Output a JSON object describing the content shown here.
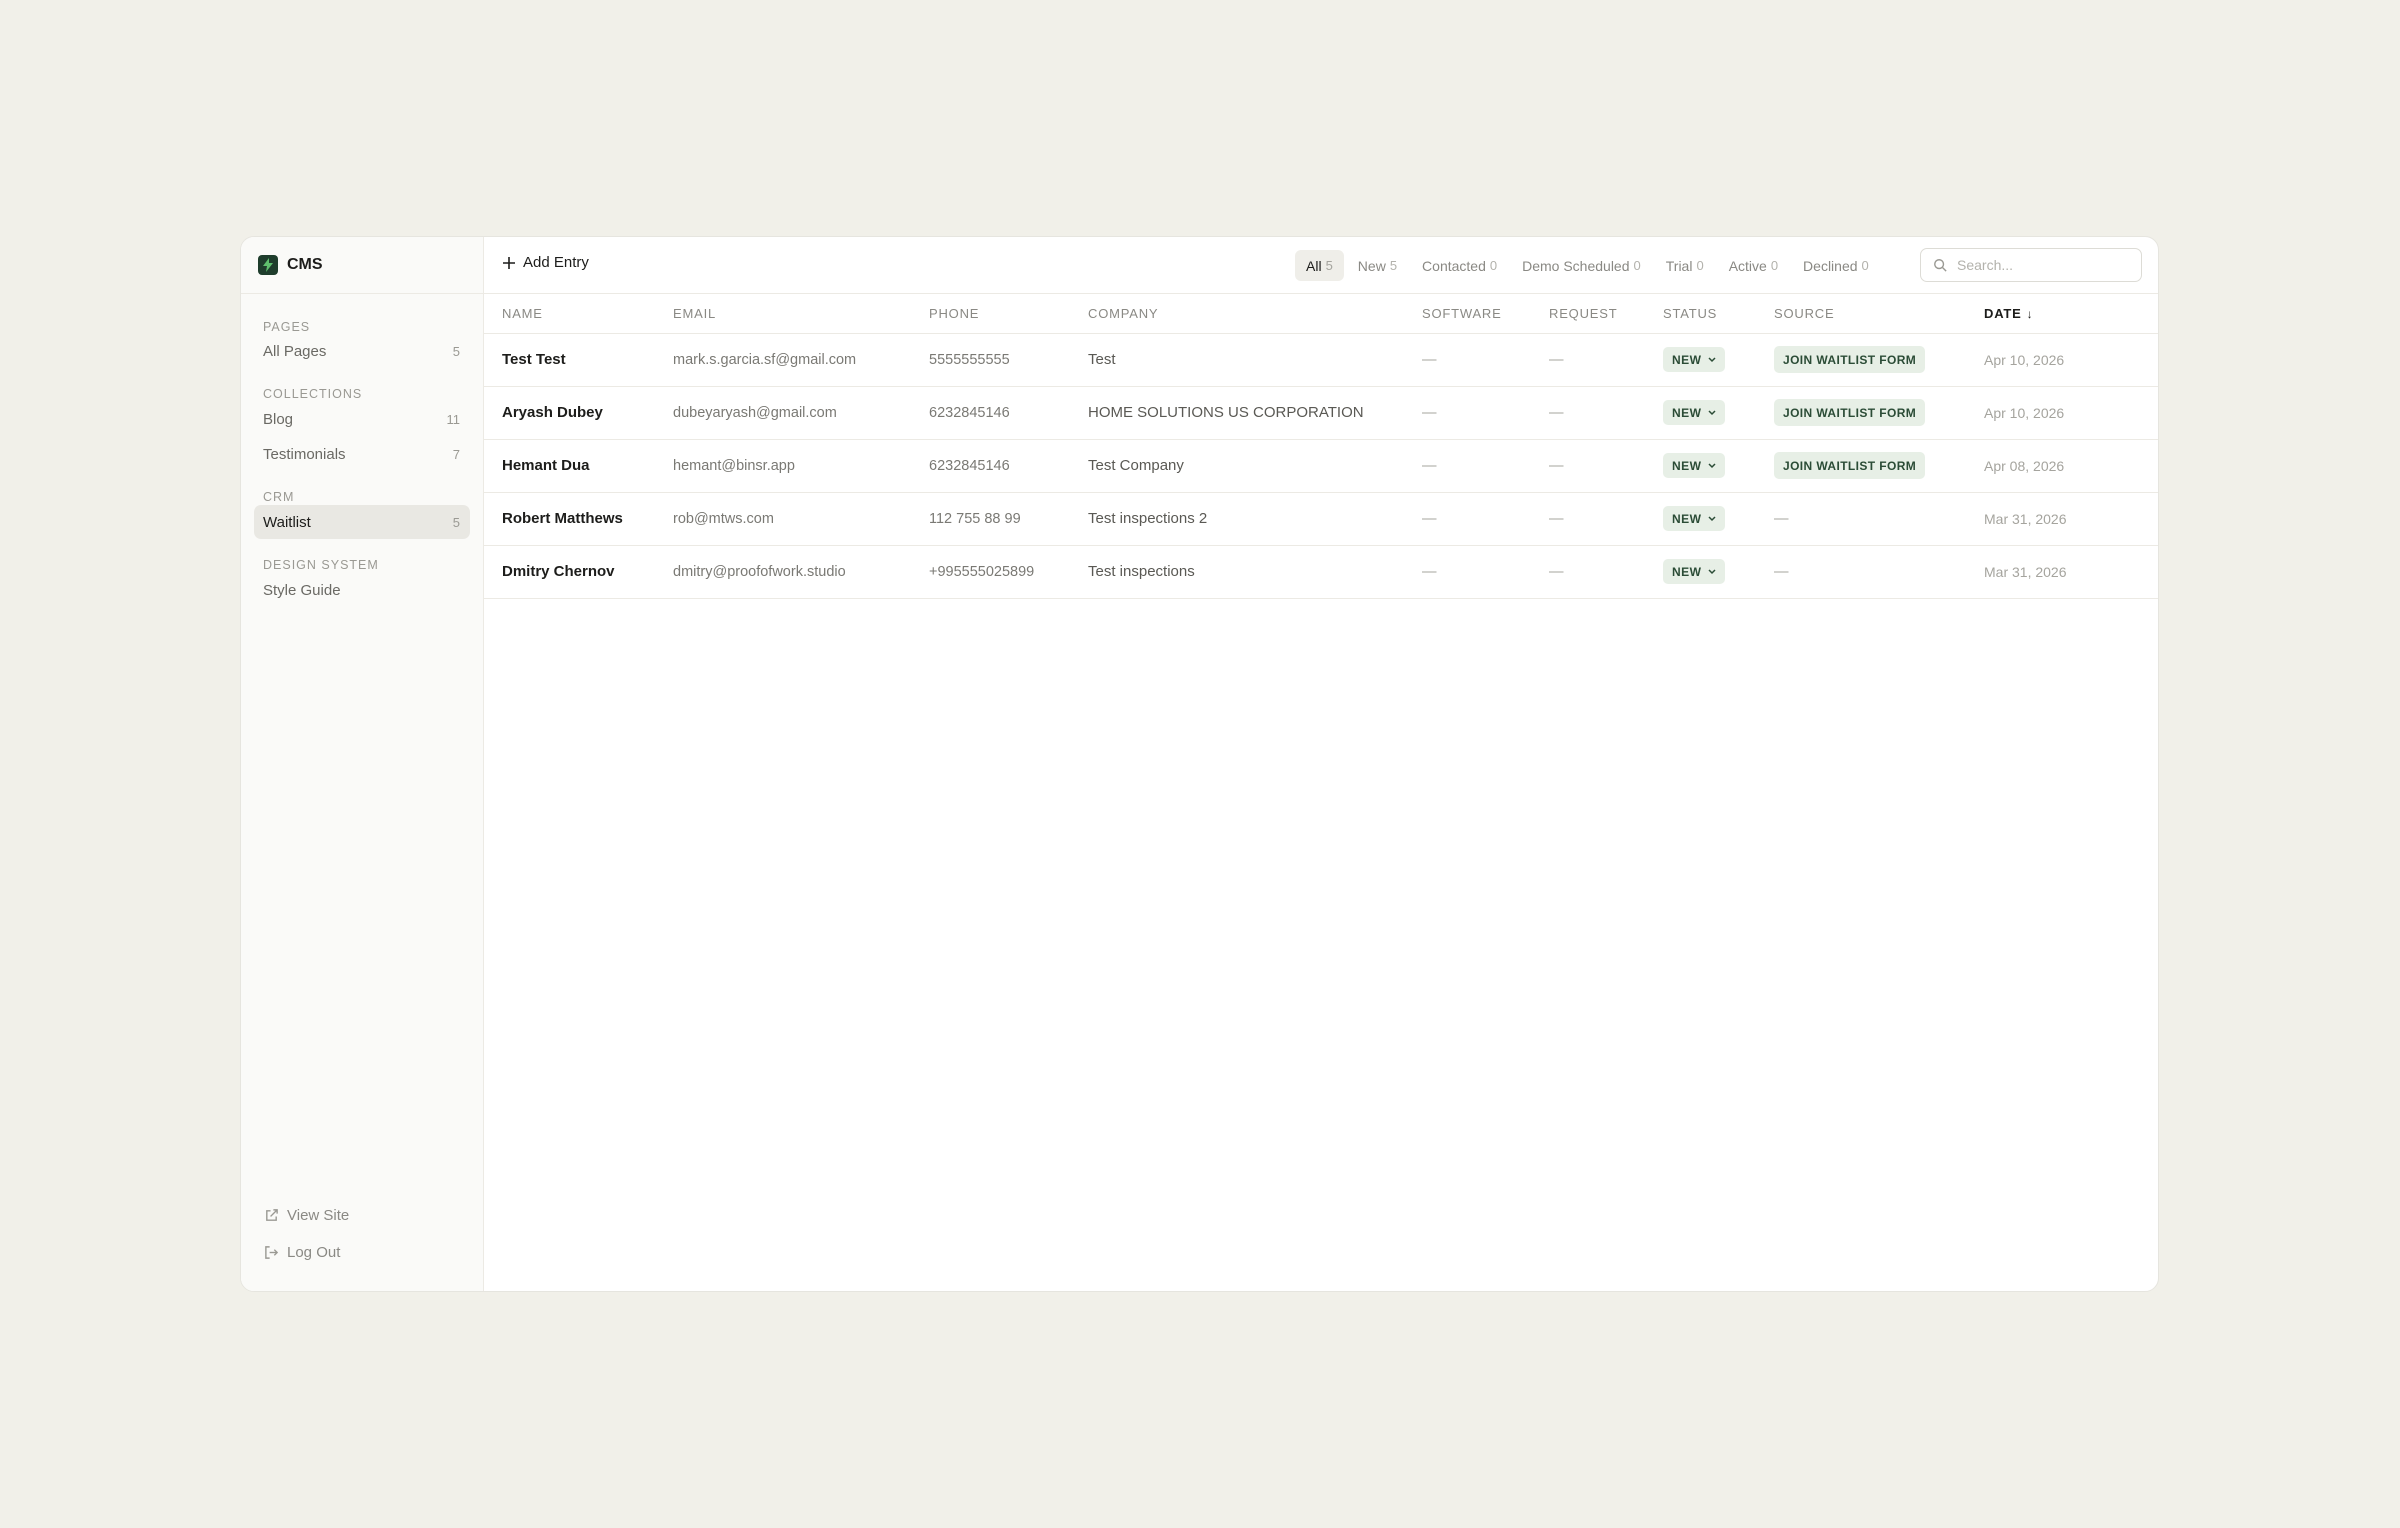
{
  "brand": {
    "title": "CMS",
    "logo_icon": "bolt-icon",
    "logo_color": "#1e3d2c"
  },
  "sidebar": {
    "sections": [
      {
        "label": "PAGES",
        "items": [
          {
            "label": "All Pages",
            "count": "5"
          }
        ]
      },
      {
        "label": "COLLECTIONS",
        "items": [
          {
            "label": "Blog",
            "count": "11"
          },
          {
            "label": "Testimonials",
            "count": "7"
          }
        ]
      },
      {
        "label": "CRM",
        "items": [
          {
            "label": "Waitlist",
            "count": "5",
            "active": true
          }
        ]
      },
      {
        "label": "DESIGN SYSTEM",
        "items": [
          {
            "label": "Style Guide",
            "count": ""
          }
        ]
      }
    ],
    "view_site": "View Site",
    "log_out": "Log Out"
  },
  "toolbar": {
    "add_entry": "Add Entry",
    "filters": [
      {
        "label": "All",
        "count": "5",
        "active": true
      },
      {
        "label": "New",
        "count": "5"
      },
      {
        "label": "Contacted",
        "count": "0"
      },
      {
        "label": "Demo Scheduled",
        "count": "0"
      },
      {
        "label": "Trial",
        "count": "0"
      },
      {
        "label": "Active",
        "count": "0"
      },
      {
        "label": "Declined",
        "count": "0"
      }
    ],
    "search_placeholder": "Search..."
  },
  "table": {
    "columns": [
      "NAME",
      "EMAIL",
      "PHONE",
      "COMPANY",
      "SOFTWARE",
      "REQUEST",
      "STATUS",
      "SOURCE",
      "DATE"
    ],
    "sort_column": "DATE",
    "sort_indicator": "↓",
    "rows": [
      {
        "name": "Test Test",
        "email": "mark.s.garcia.sf@gmail.com",
        "phone": "5555555555",
        "company": "Test",
        "software": "—",
        "request": "—",
        "status": "NEW",
        "source": "JOIN WAITLIST FORM",
        "date": "Apr 10, 2026"
      },
      {
        "name": "Aryash Dubey",
        "email": "dubeyaryash@gmail.com",
        "phone": "6232845146",
        "company": "HOME SOLUTIONS US CORPORATION",
        "software": "—",
        "request": "—",
        "status": "NEW",
        "source": "JOIN WAITLIST FORM",
        "date": "Apr 10, 2026"
      },
      {
        "name": "Hemant Dua",
        "email": "hemant@binsr.app",
        "phone": "6232845146",
        "company": "Test Company",
        "software": "—",
        "request": "—",
        "status": "NEW",
        "source": "JOIN WAITLIST FORM",
        "date": "Apr 08, 2026"
      },
      {
        "name": "Robert Matthews",
        "email": "rob@mtws.com",
        "phone": "112 755 88 99",
        "company": "Test inspections 2",
        "software": "—",
        "request": "—",
        "status": "NEW",
        "source": "—",
        "date": "Mar 31, 2026"
      },
      {
        "name": "Dmitry Chernov",
        "email": "dmitry@proofofwork.studio",
        "phone": "+995555025899",
        "company": "Test inspections",
        "software": "—",
        "request": "—",
        "status": "NEW",
        "source": "—",
        "date": "Mar 31, 2026"
      }
    ]
  },
  "colors": {
    "background": "#f1f0e9",
    "accent_badge_bg": "#e7efe6",
    "accent_badge_text": "#2b4c36"
  }
}
